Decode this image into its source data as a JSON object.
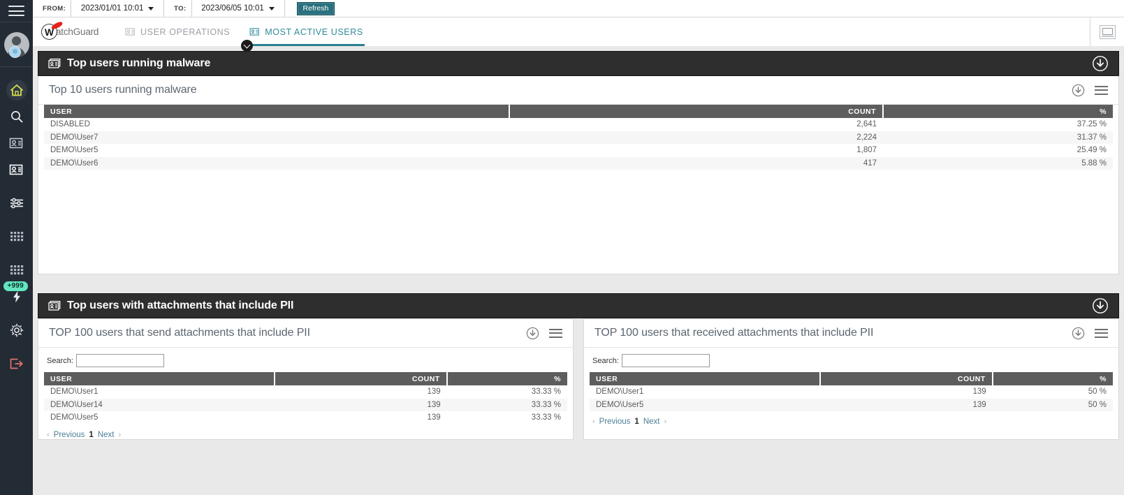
{
  "sidebar": {
    "menu_icon": "hamburger-icon",
    "avatar": "user-avatar",
    "items": [
      {
        "name": "home-icon",
        "label": "Home",
        "active": true
      },
      {
        "name": "search-icon",
        "label": "Search"
      },
      {
        "name": "card-user-icon",
        "label": "User card"
      },
      {
        "name": "card-user-alt-icon",
        "label": "User card alt"
      },
      {
        "name": "filters-icon",
        "label": "Filters"
      },
      {
        "name": "grid-icon",
        "label": "Grid"
      },
      {
        "name": "grid-alt-icon",
        "label": "Grid alt"
      },
      {
        "name": "lightning-icon",
        "label": "Alerts",
        "badge": "+999"
      },
      {
        "name": "gear-icon",
        "label": "Settings"
      },
      {
        "name": "logout-icon",
        "label": "Log out"
      }
    ]
  },
  "filterbar": {
    "from_label": "FROM:",
    "from_value": "2023/01/01 10:01",
    "to_label": "TO:",
    "to_value": "2023/06/05 10:01",
    "refresh_label": "Refresh"
  },
  "brand": {
    "mark": "W",
    "name": "atchGuard"
  },
  "tabs": [
    {
      "label": "USER OPERATIONS",
      "icon": "report-card-icon",
      "active": false
    },
    {
      "label": "MOST ACTIVE USERS",
      "icon": "report-card-icon",
      "active": true
    }
  ],
  "header_right_icon": "broken-image-icon",
  "panels": [
    {
      "title": "Top users running malware",
      "icon": "report-card-icon",
      "download_icon": "download-circle-icon",
      "widgets": [
        {
          "title": "Top 10 users running malware",
          "download_icon": "download-circle-icon",
          "menu_icon": "hamburger-menu-icon",
          "columns": [
            "USER",
            "COUNT",
            "%"
          ],
          "rows": [
            [
              "DISABLED",
              "2,641",
              "37.25 %"
            ],
            [
              "DEMO\\User7",
              "2,224",
              "31.37 %"
            ],
            [
              "DEMO\\User5",
              "1,807",
              "25.49 %"
            ],
            [
              "DEMO\\User6",
              "417",
              "5.88 %"
            ]
          ]
        }
      ]
    },
    {
      "title": "Top users with attachments that include PII",
      "icon": "report-card-icon",
      "download_icon": "download-circle-icon",
      "widgets": [
        {
          "title": "TOP 100 users that send attachments that include PII",
          "download_icon": "download-circle-icon",
          "menu_icon": "hamburger-menu-icon",
          "search_label": "Search:",
          "search_value": "",
          "columns": [
            "USER",
            "COUNT",
            "%"
          ],
          "rows": [
            [
              "DEMO\\User1",
              "139",
              "33.33 %"
            ],
            [
              "DEMO\\User14",
              "139",
              "33.33 %"
            ],
            [
              "DEMO\\User5",
              "139",
              "33.33 %"
            ]
          ],
          "pager": {
            "previous": "Previous",
            "page": "1",
            "next": "Next"
          }
        },
        {
          "title": "TOP 100 users that received attachments that include PII",
          "download_icon": "download-circle-icon",
          "menu_icon": "hamburger-menu-icon",
          "search_label": "Search:",
          "search_value": "",
          "columns": [
            "USER",
            "COUNT",
            "%"
          ],
          "rows": [
            [
              "DEMO\\User1",
              "139",
              "50 %"
            ],
            [
              "DEMO\\User5",
              "139",
              "50 %"
            ]
          ],
          "pager": {
            "previous": "Previous",
            "page": "1",
            "next": "Next"
          }
        }
      ]
    }
  ],
  "colors": {
    "sidebar_bg": "#232b35",
    "panel_header_bg": "#2e2e2e",
    "table_header_bg": "#5d5d5d",
    "accent_teal": "#2a7f91",
    "refresh_bg": "#2a707e",
    "badge_green": "#63e6c0",
    "brand_red": "#e2231a",
    "home_yellow": "#d7e04a",
    "logout_red": "#e0736d"
  }
}
